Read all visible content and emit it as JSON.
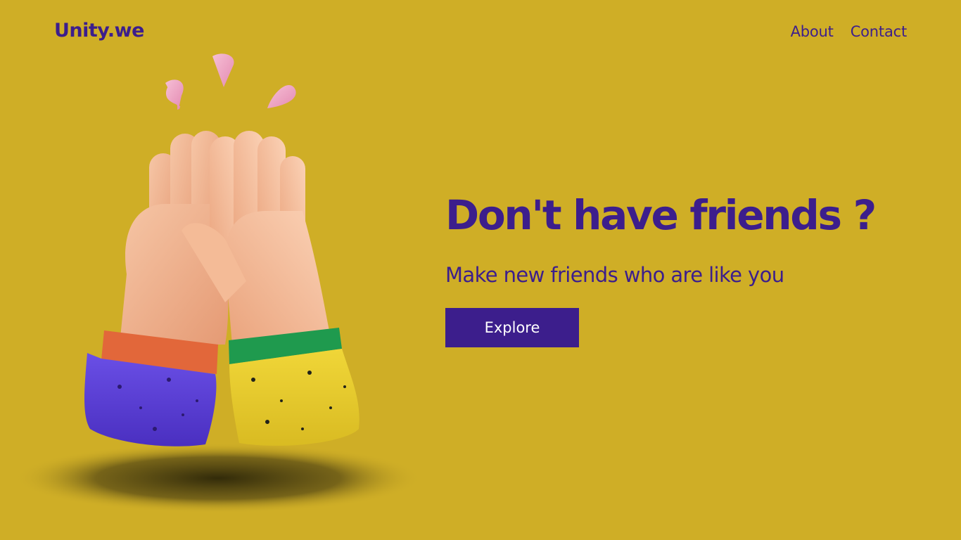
{
  "brand": {
    "logo": "Unity.we"
  },
  "nav": {
    "about": "About",
    "contact": "Contact"
  },
  "hero": {
    "headline": "Don't have friends ?",
    "subheadline": "Make new friends who are like you",
    "cta_label": "Explore"
  },
  "illustration": {
    "subject": "high-five-hands-icon",
    "colors": {
      "background": "#cfae26",
      "accent": "#3c1e8c",
      "skin": "#f0b28e",
      "left_cuff": "#5a3fd6",
      "left_band": "#e2673a",
      "right_cuff": "#e8cc2c",
      "right_band": "#1f9a4e",
      "sparkles": "#f0a8c8"
    }
  }
}
